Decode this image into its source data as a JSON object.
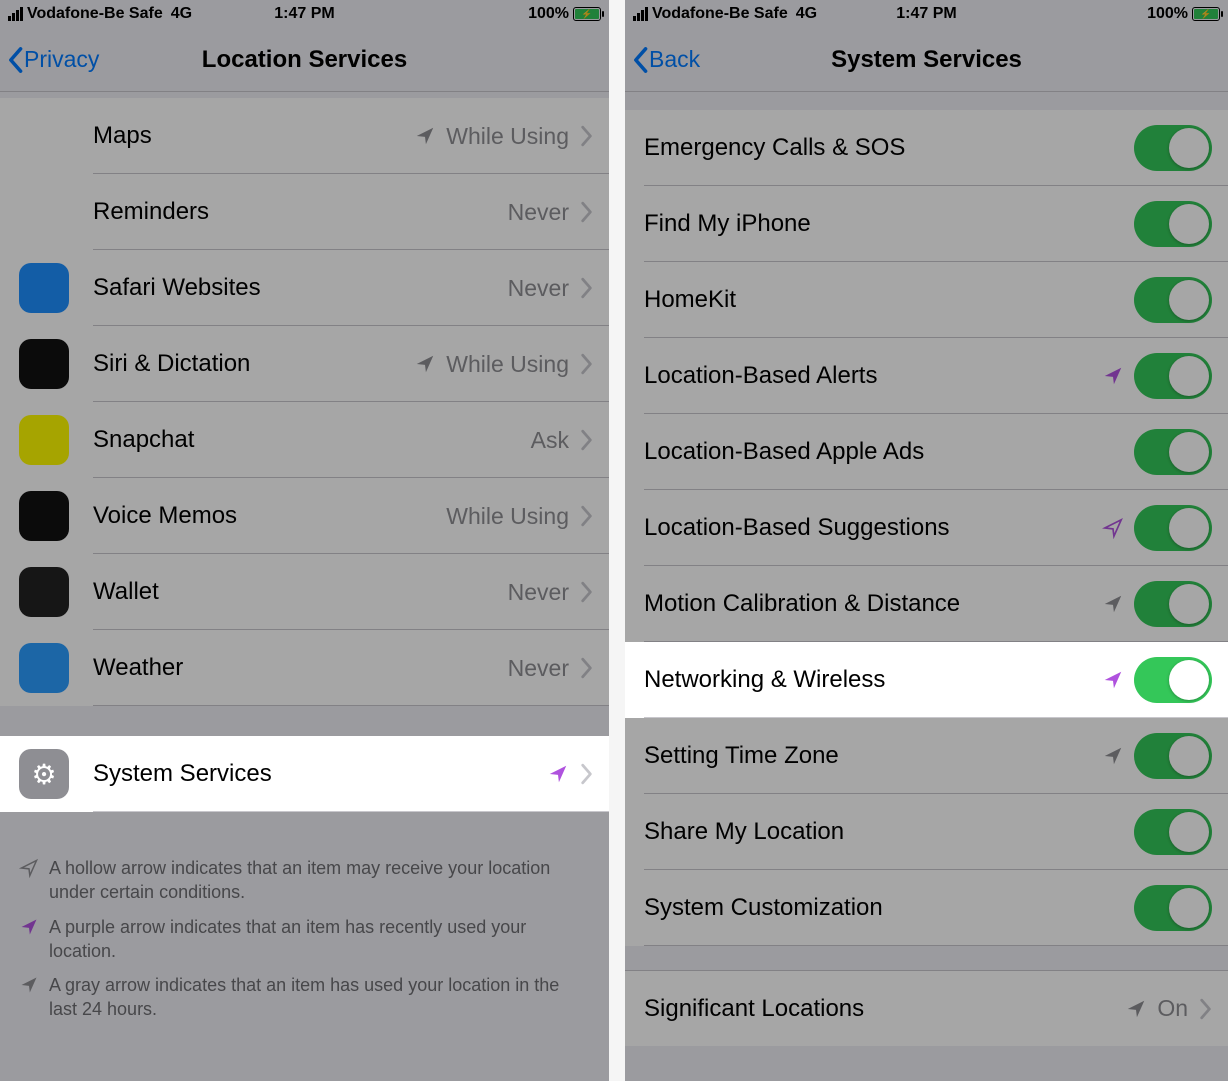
{
  "colors": {
    "accent": "#007aff",
    "toggle_on": "#34c759",
    "arrow_purple": "#af52de",
    "arrow_gray": "#8e8e93"
  },
  "statusbar": {
    "carrier": "Vodafone-Be Safe",
    "network": "4G",
    "time": "1:47 PM",
    "battery": "100%"
  },
  "left": {
    "nav_back": "Privacy",
    "nav_title": "Location Services",
    "rows": [
      {
        "name": "Maps",
        "status": "While Using",
        "arrow": "gray",
        "icon_bg": "#fff"
      },
      {
        "name": "Reminders",
        "status": "Never",
        "arrow": "",
        "icon_bg": "#fff"
      },
      {
        "name": "Safari Websites",
        "status": "Never",
        "arrow": "",
        "icon_bg": "#1e90ff"
      },
      {
        "name": "Siri & Dictation",
        "status": "While Using",
        "arrow": "gray",
        "icon_bg": "#111"
      },
      {
        "name": "Snapchat",
        "status": "Ask",
        "arrow": "",
        "icon_bg": "#fffc00"
      },
      {
        "name": "Voice Memos",
        "status": "While Using",
        "arrow": "",
        "icon_bg": "#111"
      },
      {
        "name": "Wallet",
        "status": "Never",
        "arrow": "",
        "icon_bg": "#222"
      },
      {
        "name": "Weather",
        "status": "Never",
        "arrow": "",
        "icon_bg": "#2b9dff"
      },
      {
        "name": "System Services",
        "status": "",
        "arrow": "purple",
        "icon_bg": "#8e8e93",
        "highlight": true
      }
    ],
    "legend": {
      "hollow": "A hollow arrow indicates that an item may receive your location under certain conditions.",
      "purple": "A purple arrow indicates that an item has recently used your location.",
      "gray": "A gray arrow indicates that an item has used your location in the last 24 hours."
    }
  },
  "right": {
    "nav_back": "Back",
    "nav_title": "System Services",
    "rows": [
      {
        "name": "Emergency Calls & SOS",
        "toggle": true,
        "arrow": ""
      },
      {
        "name": "Find My iPhone",
        "toggle": true,
        "arrow": ""
      },
      {
        "name": "HomeKit",
        "toggle": true,
        "arrow": ""
      },
      {
        "name": "Location-Based Alerts",
        "toggle": true,
        "arrow": "purple"
      },
      {
        "name": "Location-Based Apple Ads",
        "toggle": true,
        "arrow": ""
      },
      {
        "name": "Location-Based Suggestions",
        "toggle": true,
        "arrow": "hollow-purple"
      },
      {
        "name": "Motion Calibration & Distance",
        "toggle": true,
        "arrow": "gray"
      },
      {
        "name": "Networking & Wireless",
        "toggle": true,
        "arrow": "purple",
        "highlight": true
      },
      {
        "name": "Setting Time Zone",
        "toggle": true,
        "arrow": "gray"
      },
      {
        "name": "Share My Location",
        "toggle": true,
        "arrow": ""
      },
      {
        "name": "System Customization",
        "toggle": true,
        "arrow": ""
      }
    ],
    "footer_row": {
      "name": "Significant Locations",
      "status": "On",
      "arrow": "gray"
    }
  }
}
